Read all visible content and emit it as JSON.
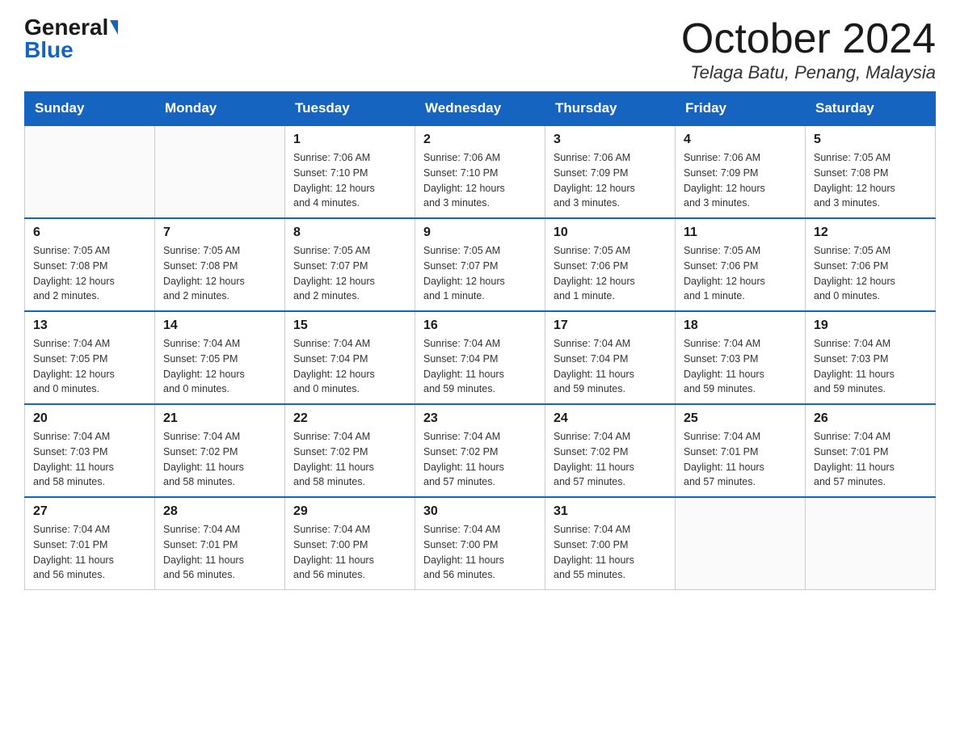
{
  "header": {
    "logo_general": "General",
    "logo_blue": "Blue",
    "month_title": "October 2024",
    "location": "Telaga Batu, Penang, Malaysia"
  },
  "days_of_week": [
    "Sunday",
    "Monday",
    "Tuesday",
    "Wednesday",
    "Thursday",
    "Friday",
    "Saturday"
  ],
  "weeks": [
    [
      {
        "day": "",
        "info": ""
      },
      {
        "day": "",
        "info": ""
      },
      {
        "day": "1",
        "info": "Sunrise: 7:06 AM\nSunset: 7:10 PM\nDaylight: 12 hours\nand 4 minutes."
      },
      {
        "day": "2",
        "info": "Sunrise: 7:06 AM\nSunset: 7:10 PM\nDaylight: 12 hours\nand 3 minutes."
      },
      {
        "day": "3",
        "info": "Sunrise: 7:06 AM\nSunset: 7:09 PM\nDaylight: 12 hours\nand 3 minutes."
      },
      {
        "day": "4",
        "info": "Sunrise: 7:06 AM\nSunset: 7:09 PM\nDaylight: 12 hours\nand 3 minutes."
      },
      {
        "day": "5",
        "info": "Sunrise: 7:05 AM\nSunset: 7:08 PM\nDaylight: 12 hours\nand 3 minutes."
      }
    ],
    [
      {
        "day": "6",
        "info": "Sunrise: 7:05 AM\nSunset: 7:08 PM\nDaylight: 12 hours\nand 2 minutes."
      },
      {
        "day": "7",
        "info": "Sunrise: 7:05 AM\nSunset: 7:08 PM\nDaylight: 12 hours\nand 2 minutes."
      },
      {
        "day": "8",
        "info": "Sunrise: 7:05 AM\nSunset: 7:07 PM\nDaylight: 12 hours\nand 2 minutes."
      },
      {
        "day": "9",
        "info": "Sunrise: 7:05 AM\nSunset: 7:07 PM\nDaylight: 12 hours\nand 1 minute."
      },
      {
        "day": "10",
        "info": "Sunrise: 7:05 AM\nSunset: 7:06 PM\nDaylight: 12 hours\nand 1 minute."
      },
      {
        "day": "11",
        "info": "Sunrise: 7:05 AM\nSunset: 7:06 PM\nDaylight: 12 hours\nand 1 minute."
      },
      {
        "day": "12",
        "info": "Sunrise: 7:05 AM\nSunset: 7:06 PM\nDaylight: 12 hours\nand 0 minutes."
      }
    ],
    [
      {
        "day": "13",
        "info": "Sunrise: 7:04 AM\nSunset: 7:05 PM\nDaylight: 12 hours\nand 0 minutes."
      },
      {
        "day": "14",
        "info": "Sunrise: 7:04 AM\nSunset: 7:05 PM\nDaylight: 12 hours\nand 0 minutes."
      },
      {
        "day": "15",
        "info": "Sunrise: 7:04 AM\nSunset: 7:04 PM\nDaylight: 12 hours\nand 0 minutes."
      },
      {
        "day": "16",
        "info": "Sunrise: 7:04 AM\nSunset: 7:04 PM\nDaylight: 11 hours\nand 59 minutes."
      },
      {
        "day": "17",
        "info": "Sunrise: 7:04 AM\nSunset: 7:04 PM\nDaylight: 11 hours\nand 59 minutes."
      },
      {
        "day": "18",
        "info": "Sunrise: 7:04 AM\nSunset: 7:03 PM\nDaylight: 11 hours\nand 59 minutes."
      },
      {
        "day": "19",
        "info": "Sunrise: 7:04 AM\nSunset: 7:03 PM\nDaylight: 11 hours\nand 59 minutes."
      }
    ],
    [
      {
        "day": "20",
        "info": "Sunrise: 7:04 AM\nSunset: 7:03 PM\nDaylight: 11 hours\nand 58 minutes."
      },
      {
        "day": "21",
        "info": "Sunrise: 7:04 AM\nSunset: 7:02 PM\nDaylight: 11 hours\nand 58 minutes."
      },
      {
        "day": "22",
        "info": "Sunrise: 7:04 AM\nSunset: 7:02 PM\nDaylight: 11 hours\nand 58 minutes."
      },
      {
        "day": "23",
        "info": "Sunrise: 7:04 AM\nSunset: 7:02 PM\nDaylight: 11 hours\nand 57 minutes."
      },
      {
        "day": "24",
        "info": "Sunrise: 7:04 AM\nSunset: 7:02 PM\nDaylight: 11 hours\nand 57 minutes."
      },
      {
        "day": "25",
        "info": "Sunrise: 7:04 AM\nSunset: 7:01 PM\nDaylight: 11 hours\nand 57 minutes."
      },
      {
        "day": "26",
        "info": "Sunrise: 7:04 AM\nSunset: 7:01 PM\nDaylight: 11 hours\nand 57 minutes."
      }
    ],
    [
      {
        "day": "27",
        "info": "Sunrise: 7:04 AM\nSunset: 7:01 PM\nDaylight: 11 hours\nand 56 minutes."
      },
      {
        "day": "28",
        "info": "Sunrise: 7:04 AM\nSunset: 7:01 PM\nDaylight: 11 hours\nand 56 minutes."
      },
      {
        "day": "29",
        "info": "Sunrise: 7:04 AM\nSunset: 7:00 PM\nDaylight: 11 hours\nand 56 minutes."
      },
      {
        "day": "30",
        "info": "Sunrise: 7:04 AM\nSunset: 7:00 PM\nDaylight: 11 hours\nand 56 minutes."
      },
      {
        "day": "31",
        "info": "Sunrise: 7:04 AM\nSunset: 7:00 PM\nDaylight: 11 hours\nand 55 minutes."
      },
      {
        "day": "",
        "info": ""
      },
      {
        "day": "",
        "info": ""
      }
    ]
  ]
}
